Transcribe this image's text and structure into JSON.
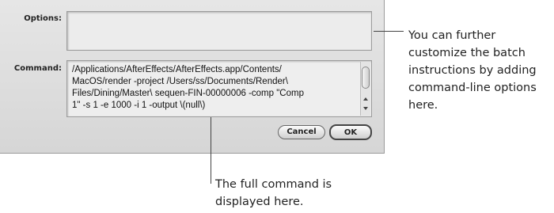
{
  "dialog": {
    "options": {
      "label": "Options:",
      "value": ""
    },
    "command": {
      "label": "Command:",
      "value": "/Applications/AfterEffects/AfterEffects.app/Contents/\nMacOS/render -project /Users/ss/Documents/Render\\\nFiles/Dining/Master\\ sequen-FIN-00000006 -comp \"Comp\n1\" -s 1 -e 1000 -i 1 -output \\(null\\)"
    },
    "buttons": {
      "cancel": "Cancel",
      "ok": "OK"
    }
  },
  "callouts": {
    "options_note": "You can further customize the batch instructions by adding command-line options here.",
    "command_note": "The full command is displayed here."
  }
}
